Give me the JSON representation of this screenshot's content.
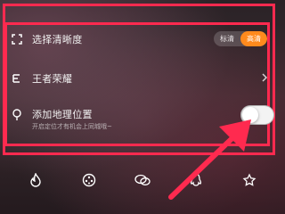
{
  "settings": {
    "clarity": {
      "label": "选择清晰度",
      "options": [
        "标清",
        "高清"
      ],
      "selected": "高清",
      "icon": "fullscreen-corners-icon"
    },
    "game": {
      "label": "王者荣耀",
      "icon": "list-lines-icon",
      "chevron": "chevron-right-icon"
    },
    "location": {
      "label": "添加地理位置",
      "sublabel": "开启定位才有机会上同城哦~",
      "icon": "location-pin-icon",
      "toggle_on": false
    }
  },
  "bottom_bar": [
    "flame-icon",
    "film-reel-icon",
    "chat-bubble-icon",
    "penguin-icon",
    "share-star-icon"
  ],
  "annotation": {
    "frame_color": "#ff2a4f",
    "accent": "#ff8a1d"
  }
}
